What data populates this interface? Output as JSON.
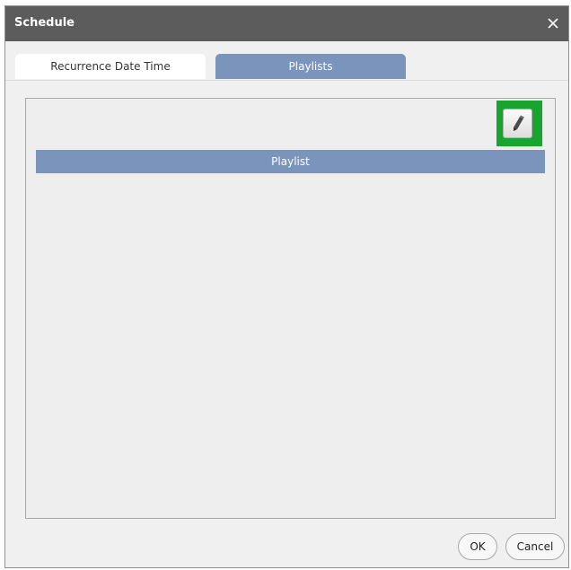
{
  "dialog": {
    "title": "Schedule",
    "close_icon": "close-icon"
  },
  "tabs": [
    {
      "label": "Recurrence Date Time",
      "active": false
    },
    {
      "label": "Playlists",
      "active": true
    }
  ],
  "playlist_panel": {
    "edit_icon": "pencil-icon",
    "column_header": "Playlist",
    "rows": []
  },
  "footer": {
    "ok_label": "OK",
    "cancel_label": "Cancel"
  },
  "colors": {
    "title_bar": "#5c5c5c",
    "accent_blue": "#7b94bc",
    "highlight_green": "#18a42e",
    "panel_bg": "#eeeeee"
  }
}
